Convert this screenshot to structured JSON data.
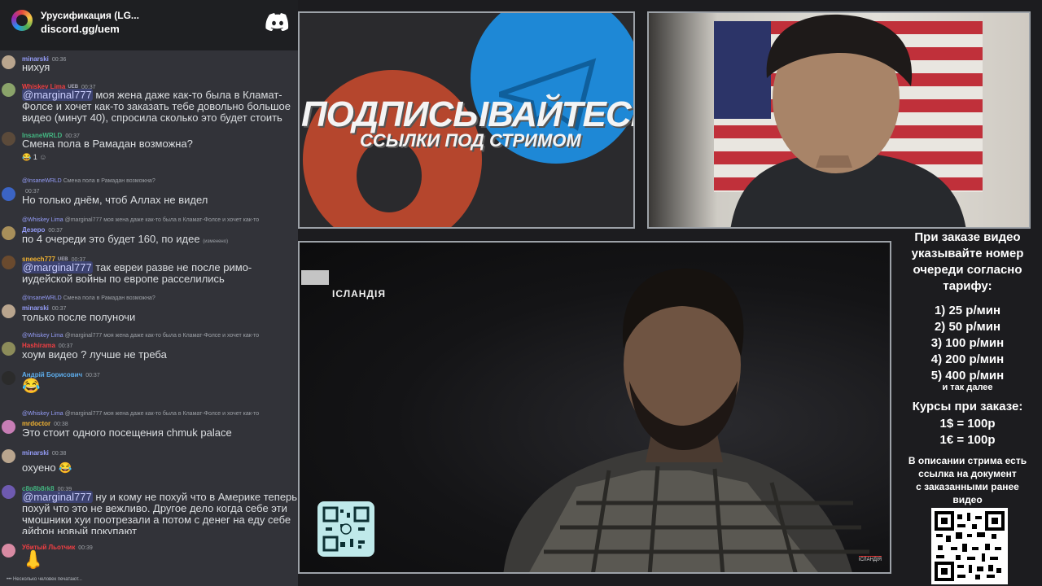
{
  "chat": {
    "server_name": "Урусификация (LG...",
    "server_link": "discord.gg/uem",
    "typing": "Несколько человек печатают...",
    "messages": [
      {
        "author": "minarski",
        "time": "00:36",
        "text": "нихуя",
        "color": "#949cf7"
      },
      {
        "author": "Whiskey Lima",
        "badge": "UEB",
        "time": "00:37",
        "mention": "@marginal777",
        "text": " моя жена даже как-то была в Кламат-Фолсе и хочет как-то заказать тебе довольно большое видео (минут 40),  спросила сколько это будет стоить",
        "color": "#f23f43"
      },
      {
        "author": "InsaneWRLD",
        "time": "00:37",
        "text": "Смена пола в Рамадан возможна?",
        "reaction": "1",
        "color": "#43b581"
      },
      {
        "reply_author": "@InsaneWRLD",
        "reply_text": "Смена пола в Рамадан возможна?",
        "author": "",
        "time": "00:37",
        "text": "Но только днём, чтоб Аллах не видел",
        "color": "#b9bbbe"
      },
      {
        "reply_author": "@Whiskey Lima",
        "reply_text": "@marginal777 моя жена даже как-то была в Кламат-Фолсе и хочет как-то",
        "author": "Дезеро",
        "time": "00:37",
        "text": "по 4 очереди это будет 160, по идее",
        "edited": "(изменено)",
        "color": "#949cf7"
      },
      {
        "author": "sneech777",
        "badge": "UEB",
        "time": "00:37",
        "mention": "@marginal777",
        "text": " так евреи разве не после римо-иудейской войны по европе расселились",
        "color": "#f0b232"
      },
      {
        "reply_author": "@InsaneWRLD",
        "reply_text": "Смена пола в Рамадан возможна?",
        "author": "minarski",
        "time": "00:37",
        "text": "только после полуночи",
        "color": "#949cf7"
      },
      {
        "reply_author": "@Whiskey Lima",
        "reply_text": "@marginal777 моя жена даже как-то была в Кламат-Фолсе и хочет как-то",
        "author": "Hashirama",
        "time": "00:37",
        "text": "хоум видео ? лучше не треба",
        "color": "#f23f43"
      },
      {
        "author": "Андрій Борисович",
        "time": "00:37",
        "text": "😂",
        "color": "#5dadec"
      },
      {
        "reply_author": "@Whiskey Lima",
        "reply_text": "@marginal777 моя жена даже как-то была в Кламат-Фолсе и хочет как-то",
        "author": "mrdoctor",
        "time": "00:38",
        "text": "Это стоит одного посещения chmuk palace",
        "color": "#f0b232"
      },
      {
        "author": "minarski",
        "time": "00:38",
        "text": "охуено 😂",
        "color": "#949cf7"
      },
      {
        "author": "c8p8b8rk8",
        "time": "00:39",
        "mention": "@marginal777",
        "text": " ну и кому не похуй что в Америке теперь похуй что это не вежливо. Другое дело когда себе эти чмошники хуи поотрезали а потом с денег на еду себе айфон новый покупают",
        "color": "#43b581"
      },
      {
        "author": "Убитый Льотчик",
        "time": "00:39",
        "text": "👃",
        "color": "#f23f43"
      }
    ]
  },
  "promo": {
    "title": "ПОДПИСЫВАЙТЕСЬ",
    "subtitle": "ССЫЛКИ ПОД СТРИМОМ"
  },
  "video": {
    "location": "ІСЛАНДІЯ"
  },
  "info": {
    "heading": [
      "При заказе видео",
      "указывайте номер",
      "очереди согласно",
      "тарифу:"
    ],
    "tariffs": [
      "1) 25 р/мин",
      "2) 50 р/мин",
      "3) 100 р/мин",
      "4) 200 р/мин",
      "5) 400 р/мин"
    ],
    "tariffs_more": "и так далее",
    "rates_heading": "Курсы при заказе:",
    "rate_usd": "1$ = 100р",
    "rate_eur": "1€ = 100р",
    "description": [
      "В описании стрима есть",
      "ссылка на документ",
      "с заказанными ранее",
      "видео"
    ]
  }
}
